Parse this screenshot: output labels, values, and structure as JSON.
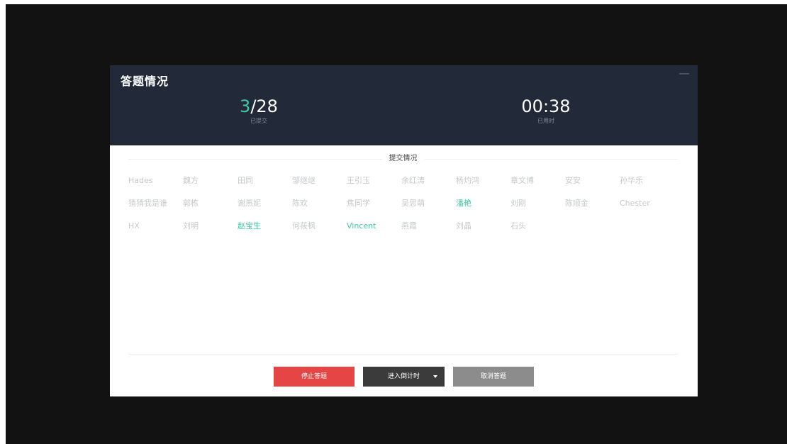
{
  "dialog": {
    "title": "答题情况"
  },
  "stats": {
    "submitted_count": "3",
    "total": "/28",
    "submitted_label": "已提交",
    "elapsed": "00:38",
    "elapsed_label": "已用时"
  },
  "submissions": {
    "title": "提交情况",
    "rows": [
      [
        {
          "name": "Hades",
          "submitted": false
        },
        {
          "name": "魏方",
          "submitted": false
        },
        {
          "name": "田同",
          "submitted": false
        },
        {
          "name": "邹继继",
          "submitted": false
        },
        {
          "name": "王引玉",
          "submitted": false
        },
        {
          "name": "余红涛",
          "submitted": false
        },
        {
          "name": "杨灼鸿",
          "submitted": false
        },
        {
          "name": "章文博",
          "submitted": false
        },
        {
          "name": "安安",
          "submitted": false
        },
        {
          "name": "孙华乐",
          "submitted": false
        }
      ],
      [
        {
          "name": "猜猜我是谁",
          "submitted": false
        },
        {
          "name": "郭栋",
          "submitted": false
        },
        {
          "name": "谢燕妮",
          "submitted": false
        },
        {
          "name": "陈欢",
          "submitted": false
        },
        {
          "name": "焦同学",
          "submitted": false
        },
        {
          "name": "吴思萌",
          "submitted": false
        },
        {
          "name": "潘艳",
          "submitted": true
        },
        {
          "name": "刘刚",
          "submitted": false
        },
        {
          "name": "陈顺金",
          "submitted": false
        },
        {
          "name": "Chester",
          "submitted": false
        }
      ],
      [
        {
          "name": "HX",
          "submitted": false
        },
        {
          "name": "刘明",
          "submitted": false
        },
        {
          "name": "赵宝生",
          "submitted": true
        },
        {
          "name": "何莜枫",
          "submitted": false
        },
        {
          "name": "Vincent",
          "submitted": true
        },
        {
          "name": "燕霞",
          "submitted": false
        },
        {
          "name": "刘晶",
          "submitted": false
        },
        {
          "name": "石头",
          "submitted": false
        }
      ]
    ]
  },
  "buttons": {
    "stop": "停止答题",
    "countdown": "进入倒计时",
    "cancel": "取消答题"
  },
  "colors": {
    "submitted": "#3fc9a5",
    "pending": "#c6c8cc",
    "header_bg": "#222938",
    "stop_btn": "#e64545",
    "countdown_btn": "#3b3b3b",
    "cancel_btn": "#8c8c8c"
  },
  "icons": {
    "minimize": "minimize-icon",
    "dropdown": "caret-down-icon"
  }
}
